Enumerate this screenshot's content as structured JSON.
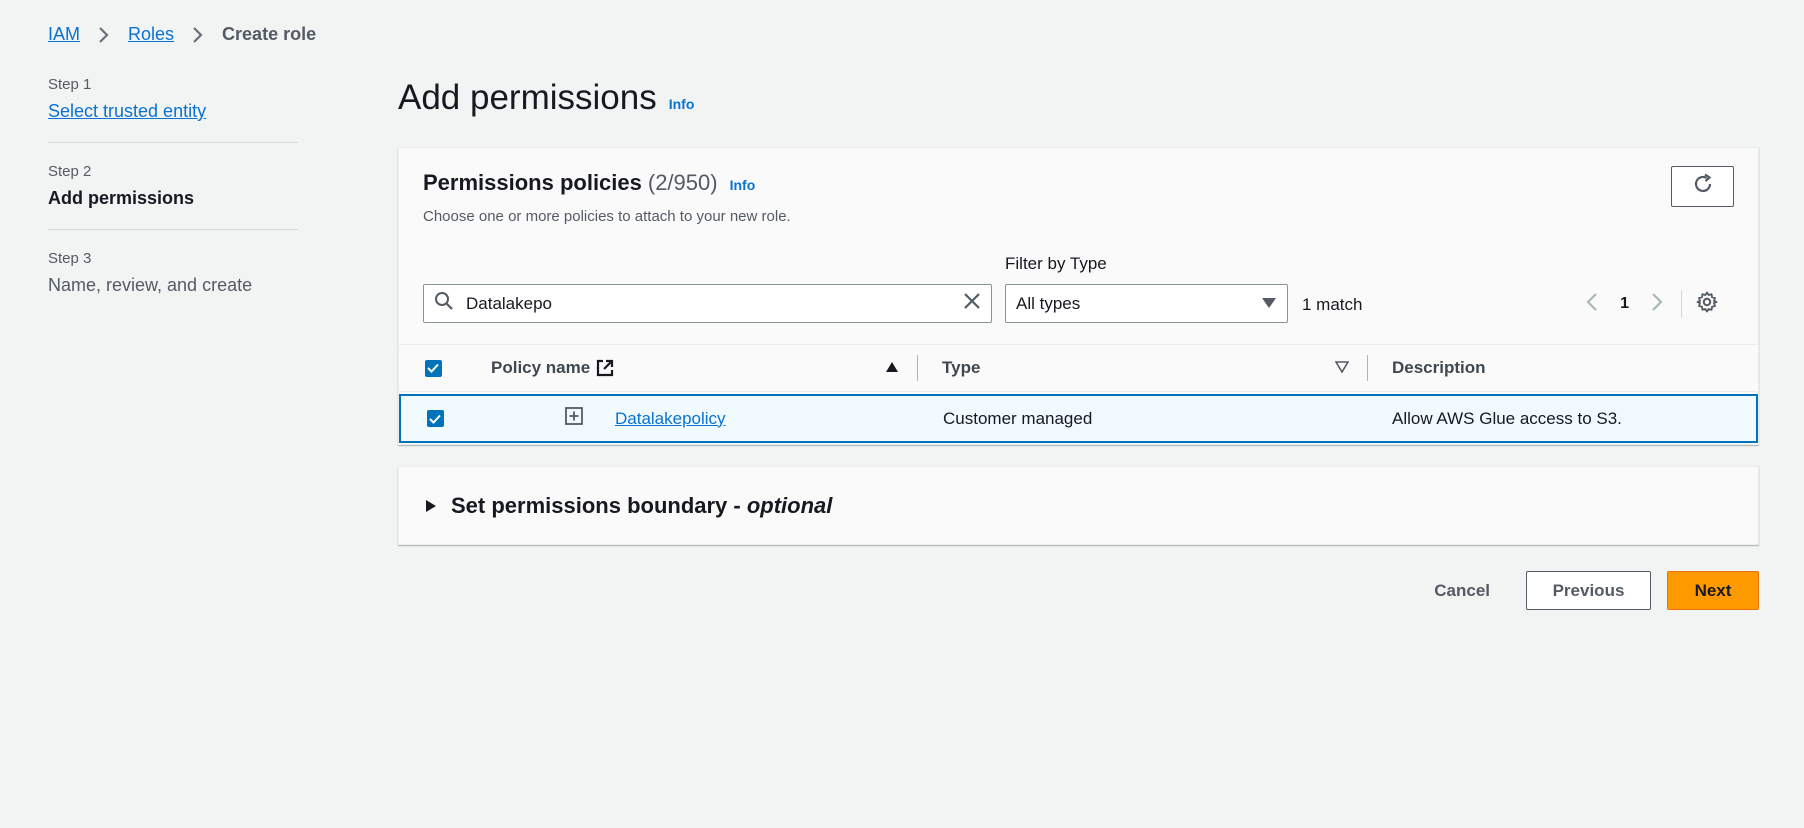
{
  "breadcrumb": {
    "items": [
      "IAM",
      "Roles"
    ],
    "current": "Create role"
  },
  "steps": [
    {
      "num": "Step 1",
      "title": "Select trusted entity"
    },
    {
      "num": "Step 2",
      "title": "Add permissions"
    },
    {
      "num": "Step 3",
      "title": "Name, review, and create"
    }
  ],
  "page": {
    "title": "Add permissions",
    "info": "Info"
  },
  "policies": {
    "title": "Permissions policies",
    "count": "(2/950)",
    "info": "Info",
    "description": "Choose one or more policies to attach to your new role.",
    "filter_label": "Filter by Type",
    "search_value": "Datalakepo",
    "type_filter": "All types",
    "matches": "1 match",
    "page": "1",
    "columns": {
      "name": "Policy name",
      "type": "Type",
      "description": "Description"
    },
    "rows": [
      {
        "name": "Datalakepolicy",
        "type": "Customer managed",
        "description": "Allow AWS Glue access to S3."
      }
    ]
  },
  "boundary": {
    "title": "Set permissions boundary - ",
    "optional": "optional"
  },
  "actions": {
    "cancel": "Cancel",
    "previous": "Previous",
    "next": "Next"
  },
  "colors": {
    "accent": "#0972d3",
    "primary_button": "#ff9900",
    "selected_row": "#f1faff"
  }
}
